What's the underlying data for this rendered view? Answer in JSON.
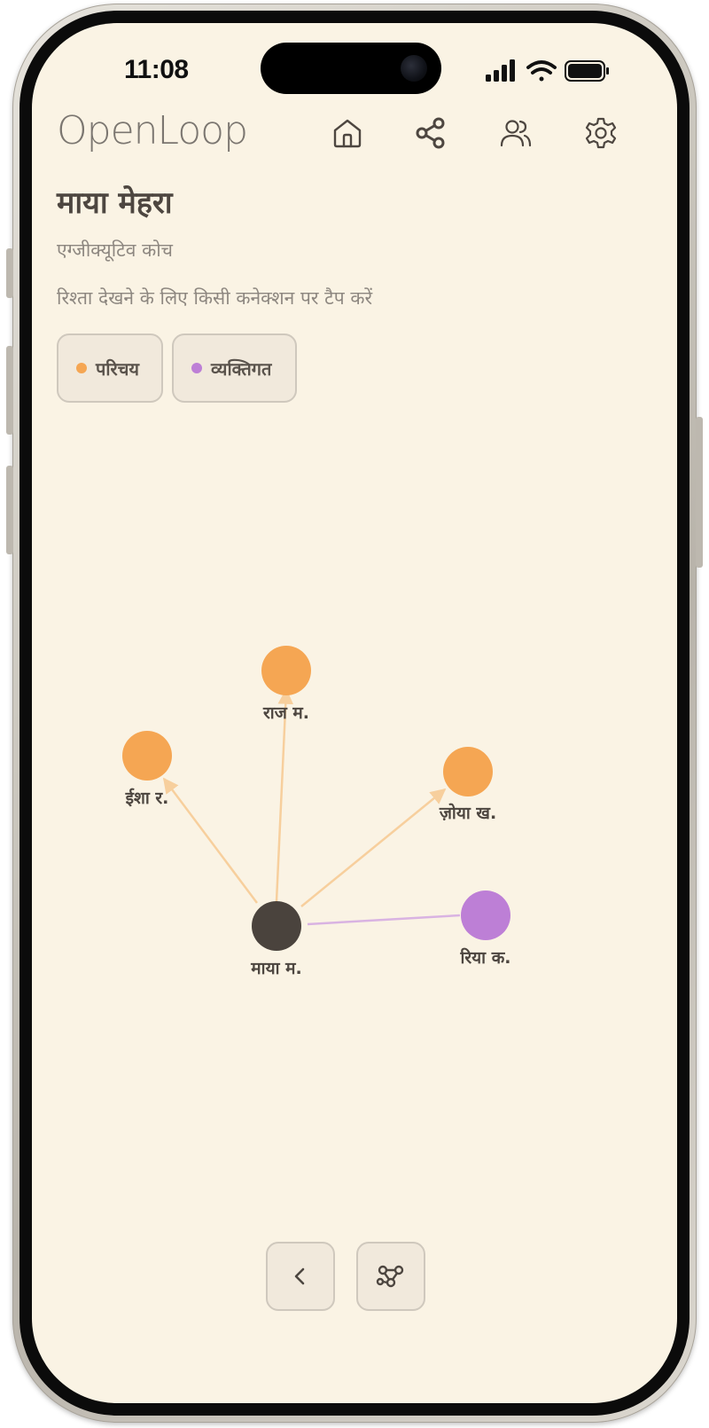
{
  "status_bar": {
    "time": "11:08"
  },
  "app": {
    "logo": "OpenLoop"
  },
  "nav": [
    {
      "name": "home-icon"
    },
    {
      "name": "share-icon"
    },
    {
      "name": "users-icon"
    },
    {
      "name": "gear-icon"
    }
  ],
  "profile": {
    "name": "माया मेहरा",
    "role": "एग्जीक्यूटिव कोच",
    "hint": "रिश्ता देखने के लिए किसी कनेक्शन पर टैप करें"
  },
  "filters": [
    {
      "label": "परिचय",
      "color": "#f5a653"
    },
    {
      "label": "व्यक्तिगत",
      "color": "#bd7fd6"
    }
  ],
  "colors": {
    "background": "#faf3e4",
    "intro": "#f5a653",
    "intro_edge": "#f7cf9d",
    "personal": "#bd7fd6",
    "personal_edge": "#d9b3e2",
    "center": "#4a433d"
  },
  "graph": {
    "center": {
      "label": "माया म."
    },
    "nodes": [
      {
        "label": "राज म.",
        "type": "intro"
      },
      {
        "label": "ईशा र.",
        "type": "intro"
      },
      {
        "label": "ज़ोया ख.",
        "type": "intro"
      },
      {
        "label": "रिया क.",
        "type": "personal"
      }
    ]
  },
  "bottom_actions": [
    {
      "name": "back-button"
    },
    {
      "name": "network-button"
    }
  ]
}
